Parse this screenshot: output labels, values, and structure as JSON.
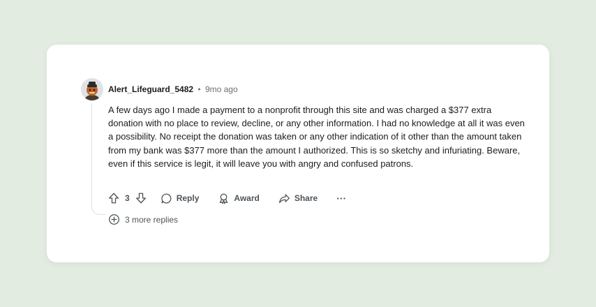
{
  "comment": {
    "username": "Alert_Lifeguard_5482",
    "separator": "•",
    "time": "9mo ago",
    "body": "A few days ago I made a payment to a nonprofit through this site and was charged a $377 extra donation with no place to review, decline, or any other information. I had no knowledge at all it was even a possibility. No receipt the donation was taken or any other indication of it other than the amount taken from my bank was $377 more than the amount I authorized. This is so sketchy and infuriating. Beware, even if this service is legit, it will leave you with angry and confused patrons.",
    "vote_count": "3",
    "actions": {
      "reply": "Reply",
      "award": "Award",
      "share": "Share",
      "more": "···"
    },
    "more_replies": "3 more replies"
  },
  "colors": {
    "page_background": "#e2ece1",
    "card_background": "#ffffff",
    "text": "#1c1c1c",
    "muted": "#4d5358"
  },
  "icons": [
    "avatar-icon",
    "upvote-icon",
    "downvote-icon",
    "reply-icon",
    "award-icon",
    "share-icon",
    "more-icon",
    "expand-plus-icon"
  ]
}
